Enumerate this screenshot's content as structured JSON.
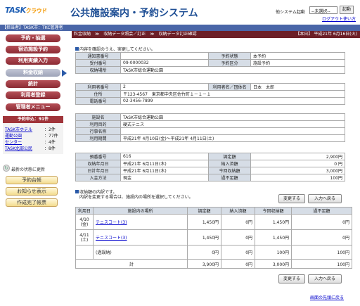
{
  "header": {
    "logo_main": "TASK",
    "logo_sub": "クラウド",
    "system_title": "公共施設案内・予約システム",
    "other_system_label": "他システム起動",
    "other_system_select": "--未選択--",
    "start_button": "起動",
    "logout": "ログアウト",
    "help": "使い方"
  },
  "topbar": {
    "left": "【担当者】TASK市：TKC管理者",
    "right": "【本日】 平成21年 6月16日(火)"
  },
  "sidebar": {
    "nav": [
      "予約・抽選",
      "宿泊施設予約",
      "利用実績入力",
      "料金収納",
      "統計",
      "利用者登録",
      "管理者メニュー"
    ],
    "requests_title": "予約申込：91件",
    "requests": [
      {
        "name": "TASK市ホテル",
        "count": "：2件"
      },
      {
        "name": "運動公園",
        "count": "：77件"
      },
      {
        "name": "センター",
        "count": "：4件"
      },
      {
        "name": "TASK北部公民",
        "count": "：8件"
      }
    ],
    "refresh": "最新の状態に更新",
    "buttons": [
      "予約台帳",
      "お知らせ表示",
      "作成完了帳票"
    ]
  },
  "breadcrumb": {
    "path": "料金収納　≫　収納データ照会／訂正　≫　収納データ訂正確認",
    "date": "【本日】 平成21年 6月16日(火)"
  },
  "msg_confirm": "内容を確認のうえ、実更してください。",
  "section1": {
    "notify_no_label": "通知書番号",
    "notify_no": "",
    "reserve_status_label": "予約状態",
    "reserve_status": "本予約",
    "receipt_no_label": "受付番号",
    "receipt_no": "09-0000032",
    "reserve_type_label": "予約区分",
    "reserve_type": "施設予約",
    "place_label": "収納場所",
    "place": "TASK市総合運動公園"
  },
  "section2": {
    "user_no_label": "利用者番号",
    "user_no": "2",
    "user_name_label": "利用者名／団体名",
    "user_name": "日本　太郎",
    "address_label": "住所",
    "address": "〒123-4567　東京都中央区佐竹町１－１－１",
    "phone_label": "電話番号",
    "phone": "02-3456-7899"
  },
  "section3": {
    "facility_label": "施設名",
    "facility": "TASK市総合運動公園",
    "purpose_label": "利用目的",
    "purpose": "硬式テニス",
    "event_label": "行事名称",
    "event": "",
    "period_label": "利用期間",
    "period": "平成21年 4月10日(金)～平成21年 4月11日(土)"
  },
  "section4": {
    "deposit_no_label": "預番番号",
    "deposit_no": "616",
    "adjust_label": "調定額",
    "adjust": "2,900円",
    "receive_date_label": "収納年月日",
    "receive_date": "平成21年 6月11日(木)",
    "paid_label": "納入済額",
    "paid": "0 円",
    "daily_date_label": "日計年月日",
    "daily_date": "平成21年 6月11日(木)",
    "this_time_label": "今回収納額",
    "this_time": "3,000円",
    "method_label": "入金方法",
    "method": "現金",
    "shortage_label": "過不足額",
    "shortage": "100円"
  },
  "note": {
    "line1": "収納額の内訳です。",
    "line2": "内訳を変更する場合は、施設内の場所を選択してください。"
  },
  "buttons": {
    "change": "変更する",
    "back": "入力へ戻る"
  },
  "detail": {
    "headers": [
      "利用日",
      "施設内の場所",
      "調定額",
      "納入済額",
      "今回収納額",
      "過不足額"
    ],
    "rows": [
      {
        "date": "4/10",
        "dow": "(金)",
        "place": "テニスコート(3)",
        "adjust": "1,450円",
        "paid": "0円",
        "now": "1,450円",
        "diff": "0円"
      },
      {
        "date": "4/11",
        "dow": "(土)",
        "place": "テニスコート(3)",
        "adjust": "1,450円",
        "paid": "0円",
        "now": "1,450円",
        "diff": "0円"
      },
      {
        "date": "",
        "dow": "",
        "place": "(過誤納)",
        "adjust": "0円",
        "paid": "0円",
        "now": "100円",
        "diff": "100円"
      }
    ],
    "total_label": "計",
    "total": {
      "adjust": "3,900円",
      "paid": "0円",
      "now": "3,000円",
      "diff": "100円"
    }
  },
  "to_top": "画面の先頭に戻る"
}
